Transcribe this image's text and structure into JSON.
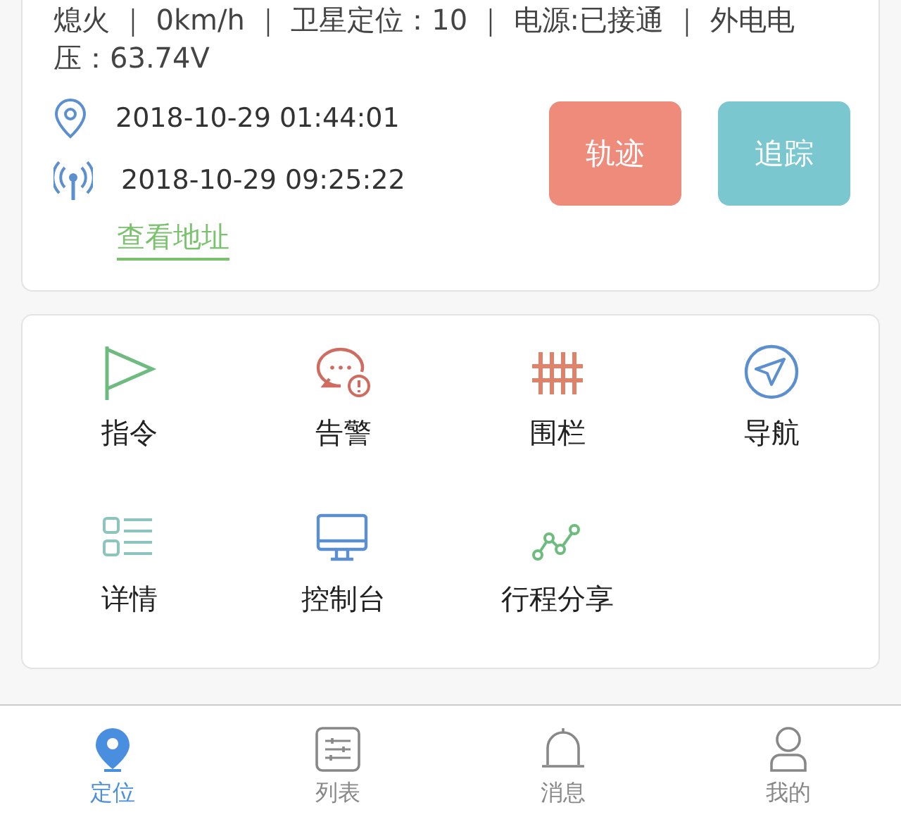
{
  "status_text": "熄火 ｜ 0km/h ｜ 卫星定位：10 ｜ 电源:已接通 ｜ 外电电压：63.74V",
  "times": [
    {
      "kind": "location",
      "text": "2018-10-29 01:44:01"
    },
    {
      "kind": "signal",
      "text": "2018-10-29 09:25:22"
    }
  ],
  "address_link": "查看地址",
  "actions": [
    {
      "kind": "track",
      "label": "轨迹"
    },
    {
      "kind": "follow",
      "label": "追踪"
    }
  ],
  "functions": [
    {
      "kind": "flag",
      "label": "指令"
    },
    {
      "kind": "alert",
      "label": "告警"
    },
    {
      "kind": "fence",
      "label": "围栏"
    },
    {
      "kind": "navigate",
      "label": "导航"
    },
    {
      "kind": "list",
      "label": "详情"
    },
    {
      "kind": "monitor",
      "label": "控制台"
    },
    {
      "kind": "share",
      "label": "行程分享"
    }
  ],
  "tabs": [
    {
      "kind": "locate",
      "label": "定位",
      "selected": true
    },
    {
      "kind": "list",
      "label": "列表",
      "selected": false
    },
    {
      "kind": "bell",
      "label": "消息",
      "selected": false
    },
    {
      "kind": "user",
      "label": "我的",
      "selected": false
    }
  ]
}
